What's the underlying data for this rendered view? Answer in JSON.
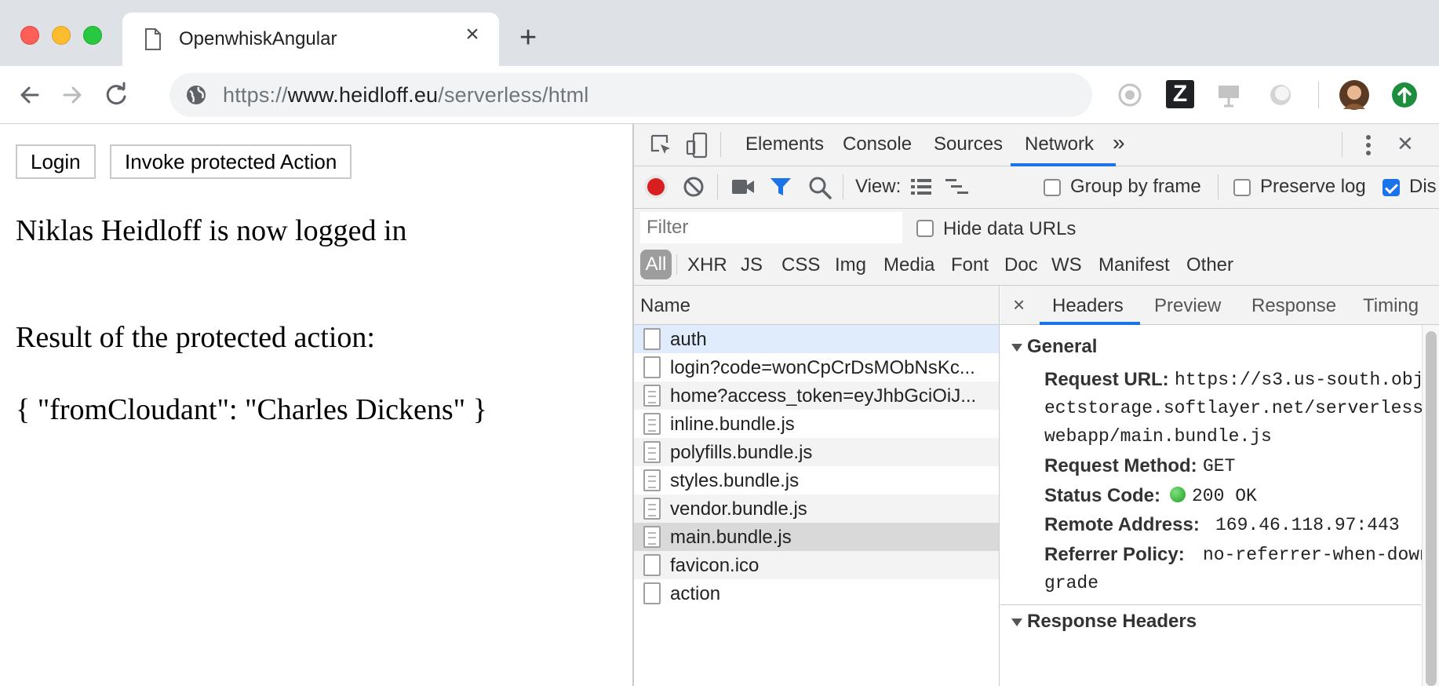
{
  "browser": {
    "tab_title": "OpenwhiskAngular",
    "tab_close": "×",
    "new_tab": "+",
    "url_scheme": "https://",
    "url_host": "www.heidloff.eu",
    "url_path": "/serverless/html"
  },
  "page": {
    "login_button": "Login",
    "invoke_button": "Invoke protected Action",
    "status_text": "Niklas Heidloff is now logged in",
    "result_label": "Result of the protected action:",
    "result_value": "{ \"fromCloudant\": \"Charles Dickens\" }"
  },
  "devtools": {
    "tabs": [
      "Elements",
      "Console",
      "Sources",
      "Network"
    ],
    "more_tabs": "»",
    "close": "✕",
    "view_label": "View:",
    "group_by_frame": "Group by frame",
    "preserve_log": "Preserve log",
    "disable_cache": "Dis",
    "filter_placeholder": "Filter",
    "hide_data_urls": "Hide data URLs",
    "filter_types": [
      "All",
      "XHR",
      "JS",
      "CSS",
      "Img",
      "Media",
      "Font",
      "Doc",
      "WS",
      "Manifest",
      "Other"
    ],
    "name_header": "Name",
    "requests": [
      "auth",
      "login?code=wonCpCrDsMObNsKc...",
      "home?access_token=eyJhbGciOiJ...",
      "inline.bundle.js",
      "polyfills.bundle.js",
      "styles.bundle.js",
      "vendor.bundle.js",
      "main.bundle.js",
      "favicon.ico",
      "action"
    ],
    "detail_close": "×",
    "detail_tabs": [
      "Headers",
      "Preview",
      "Response",
      "Timing"
    ],
    "general_title": "General",
    "request_url_key": "Request URL:",
    "request_url_line1": "https://s3.us-south.obj",
    "request_url_line2": "ectstorage.softlayer.net/serverless-",
    "request_url_line3": "webapp/main.bundle.js",
    "request_method_key": "Request Method:",
    "request_method_val": "GET",
    "status_code_key": "Status Code:",
    "status_code_val": "200 OK",
    "remote_address_key": "Remote Address:",
    "remote_address_val": "169.46.118.97:443",
    "referrer_policy_key": "Referrer Policy:",
    "referrer_policy_line1": "no-referrer-when-down",
    "referrer_policy_line2": "grade",
    "response_headers_title": "Response Headers"
  },
  "colors": {
    "accent": "#1a73e8",
    "record": "#d81e1e",
    "selected_row": "#e0ecfb",
    "highlight_row": "#d9d9d9",
    "striped_row": "#f3f3f3"
  }
}
